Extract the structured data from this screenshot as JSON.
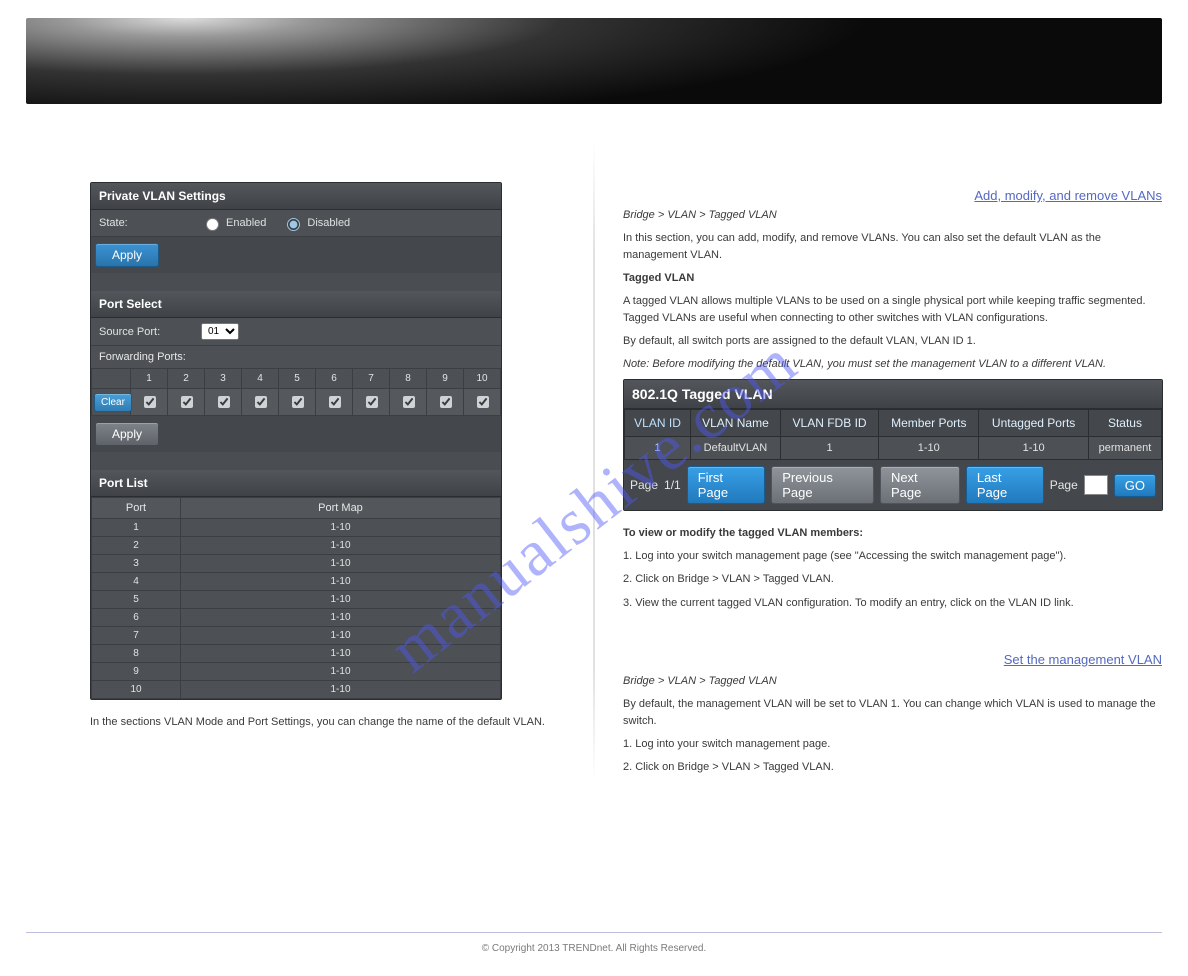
{
  "watermark": "manualshive.com",
  "left_column": {
    "intro_below_image": "In the sections VLAN Mode and Port Settings, you can change the name of the default VLAN.",
    "private_vlan": {
      "title": "Private VLAN Settings",
      "state_label": "State:",
      "enabled_label": "Enabled",
      "disabled_label": "Disabled",
      "apply_label": "Apply",
      "port_select_title": "Port Select",
      "source_port_label": "Source Port:",
      "source_port_value": "01",
      "forwarding_ports_label": "Forwarding Ports:",
      "clear_label": "Clear",
      "port_headers": [
        "1",
        "2",
        "3",
        "4",
        "5",
        "6",
        "7",
        "8",
        "9",
        "10"
      ],
      "apply2_label": "Apply",
      "port_list_title": "Port List",
      "port_col": "Port",
      "map_col": "Port Map",
      "rows": [
        {
          "port": "1",
          "map": "1-10"
        },
        {
          "port": "2",
          "map": "1-10"
        },
        {
          "port": "3",
          "map": "1-10"
        },
        {
          "port": "4",
          "map": "1-10"
        },
        {
          "port": "5",
          "map": "1-10"
        },
        {
          "port": "6",
          "map": "1-10"
        },
        {
          "port": "7",
          "map": "1-10"
        },
        {
          "port": "8",
          "map": "1-10"
        },
        {
          "port": "9",
          "map": "1-10"
        },
        {
          "port": "10",
          "map": "1-10"
        }
      ]
    }
  },
  "right_column": {
    "heading1": "Add, modify, and remove VLANs",
    "nav_heading": "Bridge > VLAN > Tagged VLAN",
    "para1": "In this section, you can add, modify, and remove VLANs. You can also set the default VLAN as the management VLAN.",
    "tagged_list_heading": "Tagged VLAN",
    "list_text": "A tagged VLAN allows multiple VLANs to be used on a single physical port while keeping traffic segmented. Tagged VLANs are useful when connecting to other switches with VLAN configurations.",
    "showing_default": "By default, all switch ports are assigned to the default VLAN, VLAN ID 1.",
    "note": "Note: Before modifying the default VLAN, you must set the management VLAN to a different VLAN.",
    "tagged_vlan": {
      "panel_title": "802.1Q Tagged VLAN",
      "cols": [
        "VLAN ID",
        "VLAN Name",
        "VLAN FDB ID",
        "Member Ports",
        "Untagged Ports",
        "Status"
      ],
      "row": {
        "id": "1",
        "name": "DefaultVLAN",
        "fdb": "1",
        "members": "1-10",
        "untagged": "1-10",
        "status": "permanent"
      },
      "page_info_prefix": "Page ",
      "page_info_value": "1/1",
      "first_label": "First Page",
      "prev_label": "Previous Page",
      "next_label": "Next Page",
      "last_label": "Last Page",
      "page_label": "Page",
      "go_label": "GO"
    },
    "steps_heading_1": "To view or modify the tagged VLAN members:",
    "steps_p1": "1. Log into your switch management page (see \"Accessing the switch management page\").",
    "steps_p2": "2. Click on Bridge > VLAN > Tagged VLAN.",
    "steps_p3": "3. View the current tagged VLAN configuration. To modify an entry, click on the VLAN ID link.",
    "link_text": "Set the management VLAN",
    "mgmt_nav": "Bridge > VLAN > Tagged VLAN",
    "mgmt_para": "By default, the management VLAN will be set to VLAN 1. You can change which VLAN is used to manage the switch.",
    "mgmt_step1": "1. Log into your switch management page.",
    "mgmt_step2": "2. Click on Bridge > VLAN > Tagged VLAN."
  },
  "copyright": "© Copyright 2013 TRENDnet. All Rights Reserved."
}
